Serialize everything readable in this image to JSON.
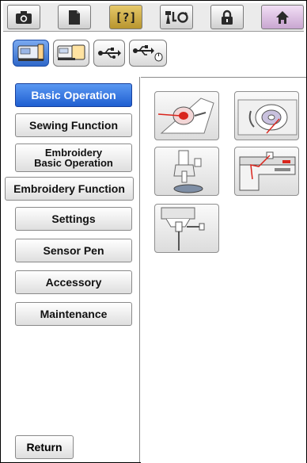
{
  "toolbar": {
    "items": [
      {
        "icon": "camera-icon"
      },
      {
        "icon": "document-icon"
      },
      {
        "icon": "help-icon",
        "label": "[?]",
        "active": true
      },
      {
        "icon": "thread-change-icon"
      },
      {
        "icon": "lock-icon"
      },
      {
        "icon": "home-icon"
      }
    ]
  },
  "mode_tabs": [
    {
      "icon": "sewing-machine-icon",
      "selected": true
    },
    {
      "icon": "embroidery-machine-icon"
    },
    {
      "icon": "usb-icon"
    },
    {
      "icon": "usb-mouse-icon"
    }
  ],
  "menu": {
    "items": [
      {
        "label": "Basic Operation",
        "selected": true
      },
      {
        "label": "Sewing Function"
      },
      {
        "label_line1": "Embroidery",
        "label_line2": "Basic Operation"
      },
      {
        "label": "Embroidery Function"
      },
      {
        "label": "Settings"
      },
      {
        "label": "Sensor Pen"
      },
      {
        "label": "Accessory"
      },
      {
        "label": "Maintenance"
      }
    ],
    "return_label": "Return"
  },
  "topics": [
    {
      "icon": "bobbin-winding-icon"
    },
    {
      "icon": "bobbin-case-icon"
    },
    {
      "icon": "presser-foot-icon"
    },
    {
      "icon": "upper-threading-icon"
    },
    {
      "icon": "needle-change-icon"
    }
  ],
  "colors": {
    "selected": "#2f6fd9",
    "active_toolbar": "#c9a640",
    "thread_red": "#d9251d"
  }
}
